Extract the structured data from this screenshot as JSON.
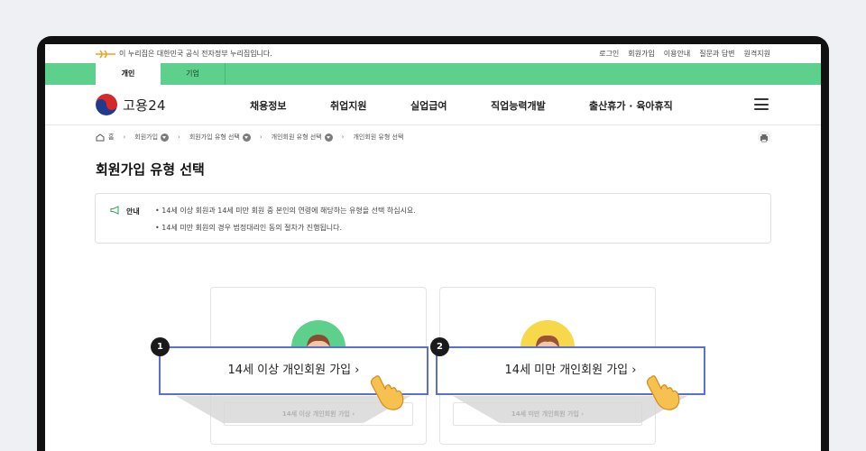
{
  "util_bar": {
    "gov_notice": "이 누리집은 대한민국 공식 전자정부 누리집입니다.",
    "links": [
      "로그인",
      "회원가입",
      "이용안내",
      "질문과 답변",
      "원격지원"
    ]
  },
  "tabs": [
    "개인",
    "기업"
  ],
  "logo": {
    "text": "고용24"
  },
  "nav": [
    "채용정보",
    "취업지원",
    "실업급여",
    "직업능력개발",
    "출산휴가 · 육아휴직"
  ],
  "breadcrumb": {
    "home": "홈",
    "items": [
      "회원가입",
      "회원가입 유형 선택",
      "개인회원 유형 선택",
      "개인회원 유형 선택"
    ]
  },
  "page_title": "회원가입 유형 선택",
  "notice": {
    "label": "안내",
    "lines": [
      "• 14세 이상 회원과 14세 미만 회원 중 본인의 연령에 해당하는 유형을 선택 하십시요.",
      "• 14세 미만 회원의 경우 법정대리인 동의 절차가 진행됩니다."
    ]
  },
  "cards": [
    {
      "button": "14세 이상 개인회원 가입  ›"
    },
    {
      "button": "14세 미만 개인회원 가입  ›"
    }
  ],
  "callouts": [
    {
      "badge": "1",
      "label": "14세 이상 개인회원 가입  ›"
    },
    {
      "badge": "2",
      "label": "14세 미만 개인회원 가입  ›"
    }
  ],
  "colors": {
    "tab_green": "#5dd18b",
    "callout_border": "#5b6fd0",
    "avatar_green": "#5dd18b",
    "avatar_yellow": "#f7d84a"
  }
}
